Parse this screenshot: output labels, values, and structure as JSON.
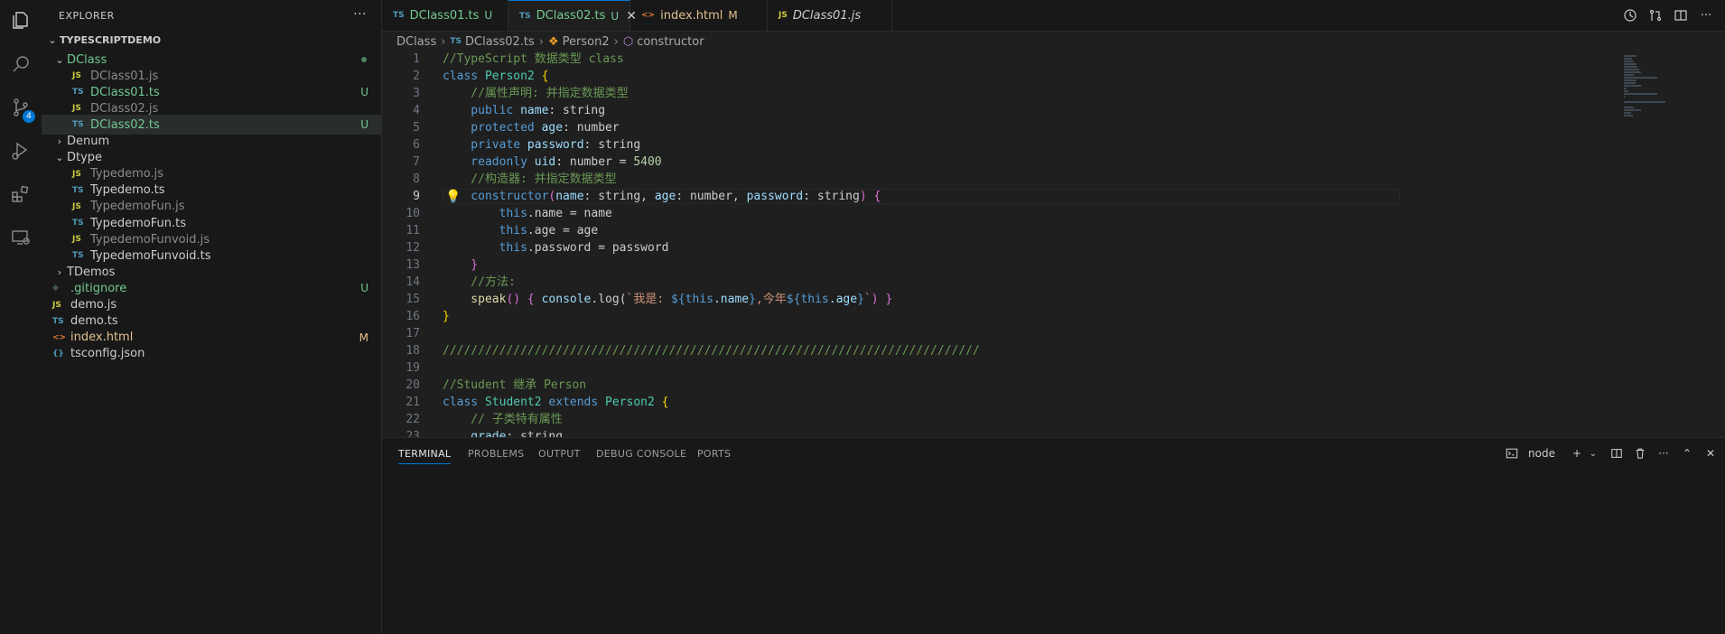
{
  "explorer": {
    "header": "EXPLORER",
    "root": "TYPESCRIPTDEMO",
    "items": [
      {
        "label": "DClass",
        "type": "folder-open",
        "depth": 1,
        "color": "#73c991",
        "status": "dot"
      },
      {
        "label": "DClass01.js",
        "type": "js",
        "depth": 2,
        "color": "#8b8b8b",
        "status": ""
      },
      {
        "label": "DClass01.ts",
        "type": "ts",
        "depth": 2,
        "color": "#73c991",
        "status": "U"
      },
      {
        "label": "DClass02.js",
        "type": "js",
        "depth": 2,
        "color": "#8b8b8b",
        "status": ""
      },
      {
        "label": "DClass02.ts",
        "type": "ts",
        "depth": 2,
        "color": "#73c991",
        "status": "U",
        "selected": true
      },
      {
        "label": "Denum",
        "type": "folder",
        "depth": 1,
        "color": "#cccccc",
        "status": ""
      },
      {
        "label": "Dtype",
        "type": "folder-open",
        "depth": 1,
        "color": "#cccccc",
        "status": ""
      },
      {
        "label": "Typedemo.js",
        "type": "js",
        "depth": 2,
        "color": "#8b8b8b",
        "status": ""
      },
      {
        "label": "Typedemo.ts",
        "type": "ts",
        "depth": 2,
        "color": "#cccccc",
        "status": ""
      },
      {
        "label": "TypedemoFun.js",
        "type": "js",
        "depth": 2,
        "color": "#8b8b8b",
        "status": ""
      },
      {
        "label": "TypedemoFun.ts",
        "type": "ts",
        "depth": 2,
        "color": "#cccccc",
        "status": ""
      },
      {
        "label": "TypedemoFunvoid.js",
        "type": "js",
        "depth": 2,
        "color": "#8b8b8b",
        "status": ""
      },
      {
        "label": "TypedemoFunvoid.ts",
        "type": "ts",
        "depth": 2,
        "color": "#cccccc",
        "status": ""
      },
      {
        "label": "TDemos",
        "type": "folder",
        "depth": 1,
        "color": "#cccccc",
        "status": ""
      },
      {
        "label": ".gitignore",
        "type": "git",
        "depth": 1,
        "color": "#73c991",
        "status": "U"
      },
      {
        "label": "demo.js",
        "type": "js",
        "depth": 1,
        "color": "#cccccc",
        "status": ""
      },
      {
        "label": "demo.ts",
        "type": "ts",
        "depth": 1,
        "color": "#cccccc",
        "status": ""
      },
      {
        "label": "index.html",
        "type": "html",
        "depth": 1,
        "color": "#e2c08d",
        "status": "M"
      },
      {
        "label": "tsconfig.json",
        "type": "json",
        "depth": 1,
        "color": "#cccccc",
        "status": ""
      }
    ]
  },
  "tabs": [
    {
      "label": "DClass01.ts",
      "type": "ts",
      "flag": "U",
      "color": "#73c991",
      "active": false
    },
    {
      "label": "DClass02.ts",
      "type": "ts",
      "flag": "U",
      "color": "#73c991",
      "active": true
    },
    {
      "label": "index.html",
      "type": "html",
      "flag": "M",
      "color": "#e2c08d",
      "active": false
    },
    {
      "label": "DClass01.js",
      "type": "js",
      "flag": "",
      "color": "#cccccc",
      "active": false,
      "italic": true
    }
  ],
  "breadcrumb": [
    "DClass",
    "DClass02.ts",
    "Person2",
    "constructor"
  ],
  "editor": {
    "current_line": 9,
    "lines": [
      {
        "n": 1,
        "t": [
          [
            "//TypeScript 数据类型 class",
            "#6a9955"
          ]
        ]
      },
      {
        "n": 2,
        "t": [
          [
            "class ",
            "#569cd6"
          ],
          [
            "Person2 ",
            "#4ec9b0"
          ],
          [
            "{",
            "#ffd700"
          ]
        ]
      },
      {
        "n": 3,
        "t": [
          [
            "    //属性声明: 并指定数据类型",
            "#6a9955"
          ]
        ]
      },
      {
        "n": 4,
        "t": [
          [
            "    public ",
            "#569cd6"
          ],
          [
            "name",
            "#9cdcfe"
          ],
          [
            ": string",
            "#cccccc"
          ]
        ]
      },
      {
        "n": 5,
        "t": [
          [
            "    protected ",
            "#569cd6"
          ],
          [
            "age",
            "#9cdcfe"
          ],
          [
            ": number",
            "#cccccc"
          ]
        ]
      },
      {
        "n": 6,
        "t": [
          [
            "    private ",
            "#569cd6"
          ],
          [
            "password",
            "#9cdcfe"
          ],
          [
            ": string",
            "#cccccc"
          ]
        ]
      },
      {
        "n": 7,
        "t": [
          [
            "    readonly ",
            "#569cd6"
          ],
          [
            "uid",
            "#9cdcfe"
          ],
          [
            ": number = ",
            "#cccccc"
          ],
          [
            "5400",
            "#b5cea8"
          ]
        ]
      },
      {
        "n": 8,
        "t": [
          [
            "    //构造器: 并指定数据类型",
            "#6a9955"
          ]
        ]
      },
      {
        "n": 9,
        "t": [
          [
            "    constructor",
            "#569cd6"
          ],
          [
            "(",
            "#da70d6"
          ],
          [
            "name",
            "#9cdcfe"
          ],
          [
            ": string, ",
            "#cccccc"
          ],
          [
            "age",
            "#9cdcfe"
          ],
          [
            ": number, ",
            "#cccccc"
          ],
          [
            "password",
            "#9cdcfe"
          ],
          [
            ": string",
            "#cccccc"
          ],
          [
            ") {",
            "#da70d6"
          ]
        ]
      },
      {
        "n": 10,
        "t": [
          [
            "        this",
            "#569cd6"
          ],
          [
            ".name = name",
            "#cccccc"
          ]
        ]
      },
      {
        "n": 11,
        "t": [
          [
            "        this",
            "#569cd6"
          ],
          [
            ".age = age",
            "#cccccc"
          ]
        ]
      },
      {
        "n": 12,
        "t": [
          [
            "        this",
            "#569cd6"
          ],
          [
            ".password = password",
            "#cccccc"
          ]
        ]
      },
      {
        "n": 13,
        "t": [
          [
            "    }",
            "#da70d6"
          ]
        ]
      },
      {
        "n": 14,
        "t": [
          [
            "    //方法:",
            "#6a9955"
          ]
        ]
      },
      {
        "n": 15,
        "t": [
          [
            "    speak",
            "#dcdcaa"
          ],
          [
            "() { ",
            "#da70d6"
          ],
          [
            "console",
            "#9cdcfe"
          ],
          [
            ".log(",
            "#cccccc"
          ],
          [
            "`我是: ",
            "#ce9178"
          ],
          [
            "${",
            "#569cd6"
          ],
          [
            "this",
            "#569cd6"
          ],
          [
            ".name",
            "#9cdcfe"
          ],
          [
            "}",
            "#569cd6"
          ],
          [
            ",今年",
            "#ce9178"
          ],
          [
            "${",
            "#569cd6"
          ],
          [
            "this",
            "#569cd6"
          ],
          [
            ".age",
            "#9cdcfe"
          ],
          [
            "}",
            "#569cd6"
          ],
          [
            "`",
            "#ce9178"
          ],
          [
            ") }",
            "#da70d6"
          ]
        ]
      },
      {
        "n": 16,
        "t": [
          [
            "}",
            "#ffd700"
          ]
        ]
      },
      {
        "n": 17,
        "t": [
          [
            "",
            "#cccccc"
          ]
        ]
      },
      {
        "n": 18,
        "t": [
          [
            "////////////////////////////////////////////////////////////////////////////",
            "#6a9955"
          ]
        ]
      },
      {
        "n": 19,
        "t": [
          [
            "",
            "#cccccc"
          ]
        ]
      },
      {
        "n": 20,
        "t": [
          [
            "//Student 继承 Person",
            "#6a9955"
          ]
        ]
      },
      {
        "n": 21,
        "t": [
          [
            "class ",
            "#569cd6"
          ],
          [
            "Student2 ",
            "#4ec9b0"
          ],
          [
            "extends ",
            "#569cd6"
          ],
          [
            "Person2 ",
            "#4ec9b0"
          ],
          [
            "{",
            "#ffd700"
          ]
        ]
      },
      {
        "n": 22,
        "t": [
          [
            "    // 子类特有属性",
            "#6a9955"
          ]
        ]
      },
      {
        "n": 23,
        "t": [
          [
            "    grade",
            "#9cdcfe"
          ],
          [
            ": string",
            "#cccccc"
          ]
        ]
      }
    ]
  },
  "panel": {
    "tabs": [
      "TERMINAL",
      "PROBLEMS",
      "OUTPUT",
      "DEBUG CONSOLE",
      "PORTS"
    ],
    "active": "TERMINAL",
    "terminal_name": "node"
  },
  "scm_badge": "4",
  "icons": [
    "explorer-icon",
    "search-icon",
    "source-control-icon",
    "run-debug-icon",
    "extensions-icon",
    "remote-explorer-icon"
  ]
}
